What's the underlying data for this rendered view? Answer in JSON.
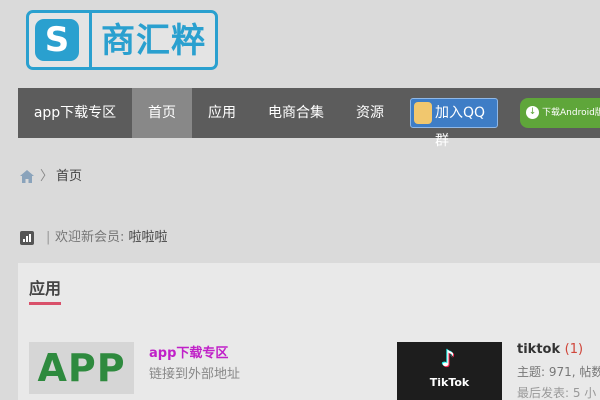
{
  "logo": {
    "mark": "S",
    "name": "商汇粹"
  },
  "nav": {
    "items": [
      {
        "label": "app下载专区"
      },
      {
        "label": "首页"
      },
      {
        "label": "应用"
      },
      {
        "label": "电商合集"
      },
      {
        "label": "资源"
      }
    ],
    "qq_group": "加入QQ群",
    "android_download": "下载Android版"
  },
  "breadcrumb": {
    "separator": "〉",
    "current": "首页"
  },
  "welcome": {
    "separator": "|",
    "text": "欢迎新会员: ",
    "username": "啦啦啦"
  },
  "section": {
    "title": "应用",
    "forums": [
      {
        "thumb_text": "APP",
        "name": "app下载专区",
        "desc": "链接到外部地址"
      },
      {
        "thumb_text": "TikTok",
        "name": "tiktok",
        "count": "(1)",
        "stats": "主题: 971, 帖数",
        "last_post": "最后发表: 5 小"
      }
    ]
  },
  "colors": {
    "brand": "#2aa0cf",
    "nav_bg": "#5c5c5c",
    "accent_underline": "#d9506a",
    "link_purple": "#c020c8"
  }
}
